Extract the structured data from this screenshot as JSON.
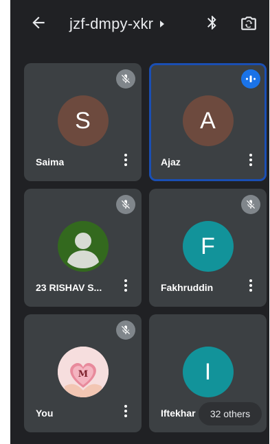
{
  "header": {
    "meeting_code": "jzf-dmpy-xkr"
  },
  "tiles": [
    {
      "name": "Saima",
      "initial": "S",
      "avatar_color": "#6d4a3e",
      "mic": "muted"
    },
    {
      "name": "Ajaz",
      "initial": "A",
      "avatar_color": "#6d4a3e",
      "mic": "speaking",
      "active": true
    },
    {
      "name": "23 RISHAV S...",
      "initial": "",
      "avatar_color": "#33691e",
      "mic": "muted"
    },
    {
      "name": "Fakhruddin",
      "initial": "F",
      "avatar_color": "#12939a",
      "mic": "muted"
    },
    {
      "name": "You",
      "initial": "M",
      "avatar_color": "#f8d3d3",
      "mic": "muted"
    },
    {
      "name": "Iftekhar",
      "initial": "I",
      "avatar_color": "#12939a",
      "mic": "none"
    }
  ],
  "others_label": "32 others",
  "colors": {
    "background": "#202124",
    "tile": "#3c4043",
    "active_border": "#1a4fb4",
    "speaking": "#1a73e8"
  }
}
